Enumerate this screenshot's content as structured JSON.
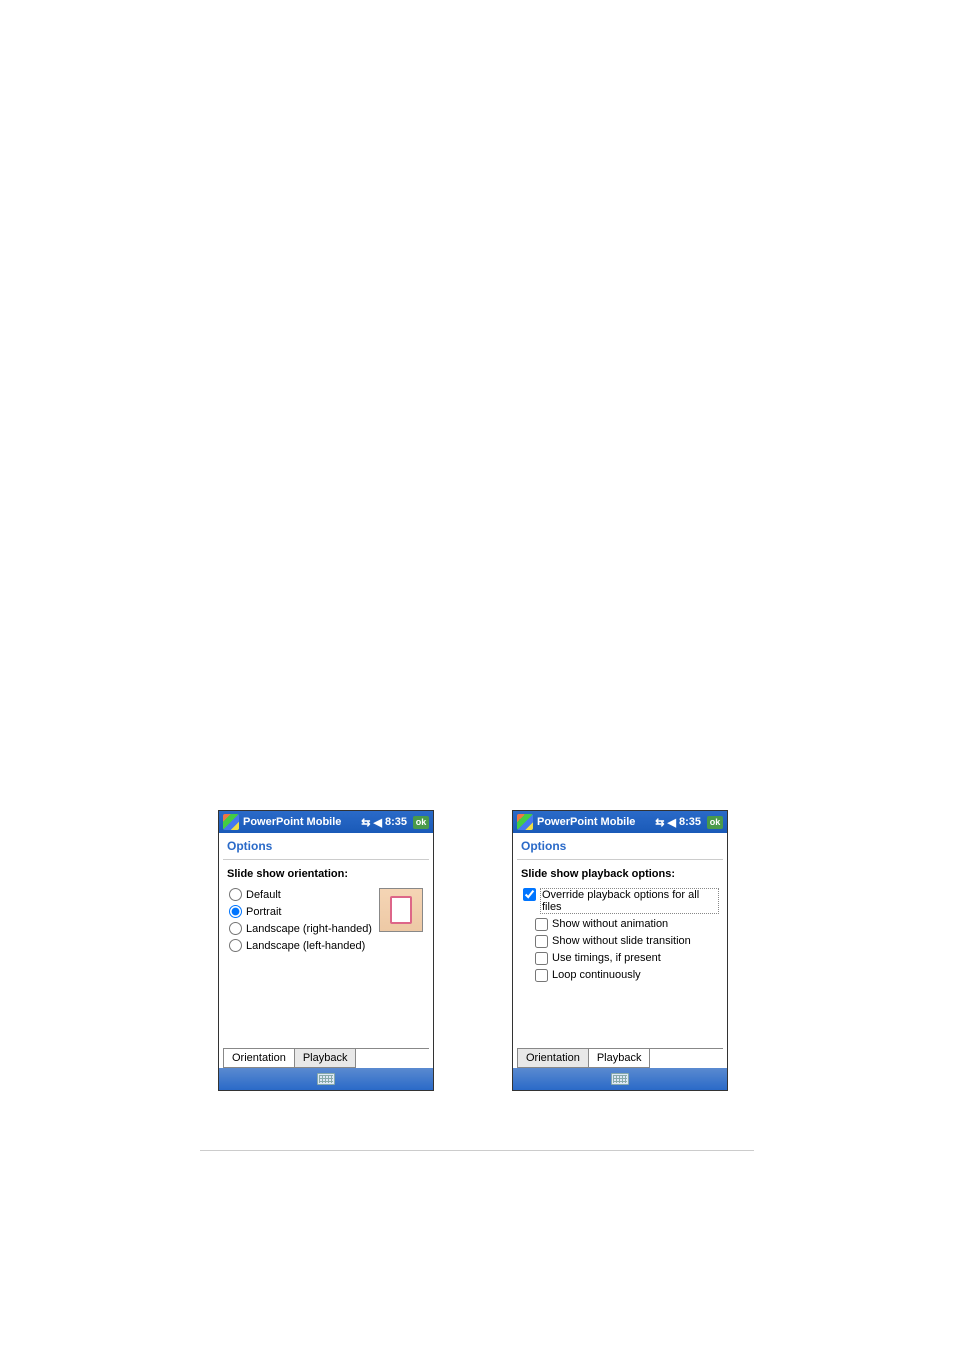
{
  "screen1": {
    "titlebar": {
      "app_name": "PowerPoint Mobile",
      "time": "8:35",
      "ok": "ok"
    },
    "subheader": "Options",
    "group_title": "Slide show orientation:",
    "radios": [
      {
        "label": "Default",
        "checked": false
      },
      {
        "label": "Portrait",
        "checked": true
      },
      {
        "label": "Landscape (right-handed)",
        "checked": false
      },
      {
        "label": "Landscape (left-handed)",
        "checked": false
      }
    ],
    "tabs": [
      {
        "label": "Orientation",
        "active": true
      },
      {
        "label": "Playback",
        "active": false
      }
    ]
  },
  "screen2": {
    "titlebar": {
      "app_name": "PowerPoint Mobile",
      "time": "8:35",
      "ok": "ok"
    },
    "subheader": "Options",
    "group_title": "Slide show playback options:",
    "main_check": {
      "label": "Override playback options for all files",
      "checked": true
    },
    "sub_checks": [
      {
        "label": "Show without animation",
        "checked": false
      },
      {
        "label": "Show without slide transition",
        "checked": false
      },
      {
        "label": "Use timings, if present",
        "checked": false
      },
      {
        "label": "Loop continuously",
        "checked": false
      }
    ],
    "tabs": [
      {
        "label": "Orientation",
        "active": false
      },
      {
        "label": "Playback",
        "active": true
      }
    ]
  }
}
